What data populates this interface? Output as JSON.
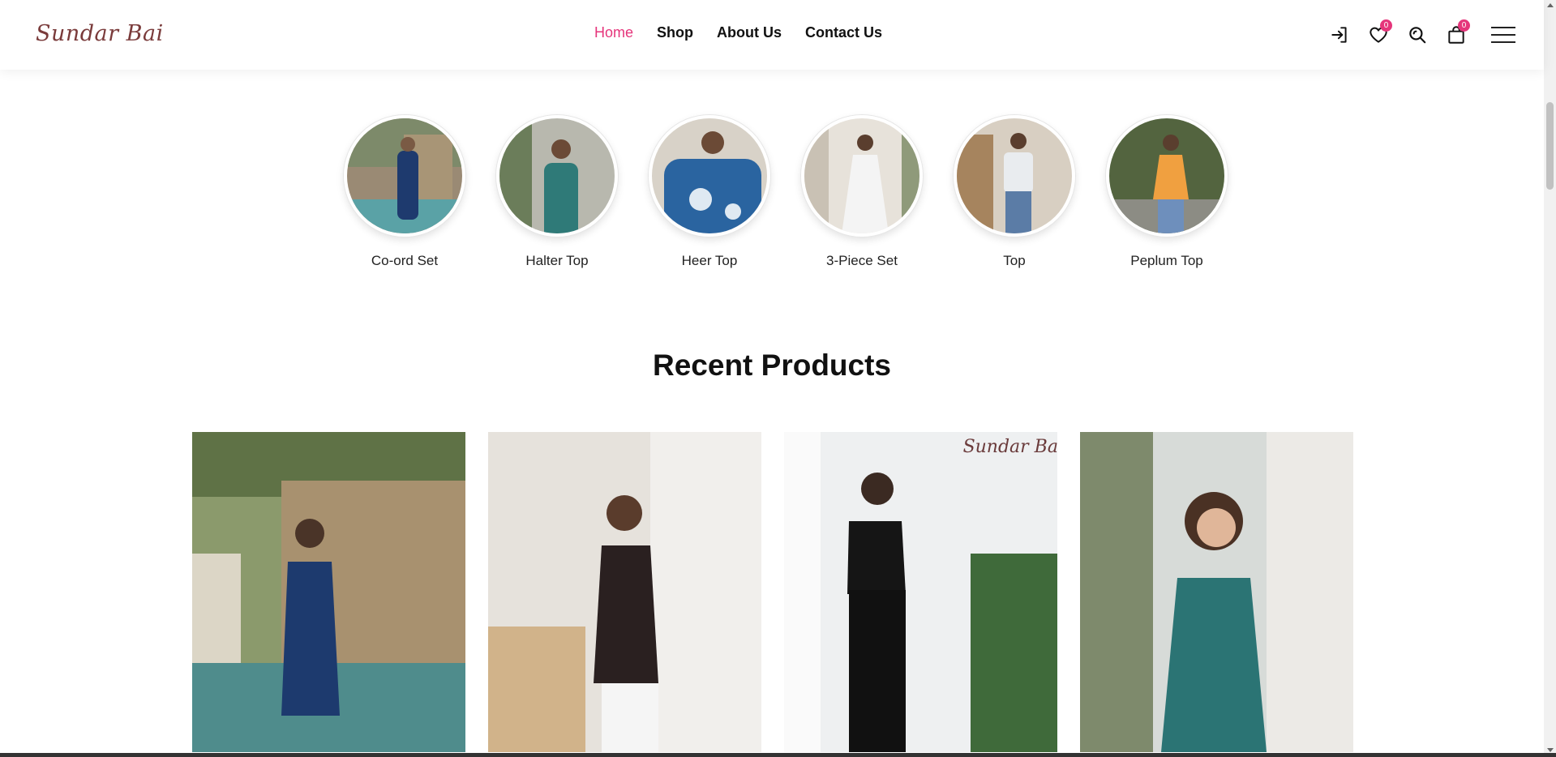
{
  "brand": {
    "logo_text": "Sundar Bai",
    "accent_color": "#e5357b"
  },
  "nav": {
    "items": [
      {
        "label": "Home",
        "active": true
      },
      {
        "label": "Shop",
        "active": false
      },
      {
        "label": "About Us",
        "active": false
      },
      {
        "label": "Contact Us",
        "active": false
      }
    ]
  },
  "header_icons": {
    "login_icon": "login-icon",
    "wishlist_icon": "heart-icon",
    "wishlist_count": "0",
    "search_icon": "search-icon",
    "cart_icon": "shopping-bag-icon",
    "cart_count": "0",
    "menu_icon": "hamburger-menu-icon"
  },
  "categories": [
    {
      "label": "Co-ord Set"
    },
    {
      "label": "Halter Top"
    },
    {
      "label": "Heer Top"
    },
    {
      "label": "3-Piece Set"
    },
    {
      "label": "Top"
    },
    {
      "label": "Peplum Top"
    }
  ],
  "recent_products": {
    "title": "Recent Products",
    "watermark": "Sundar Bai"
  }
}
